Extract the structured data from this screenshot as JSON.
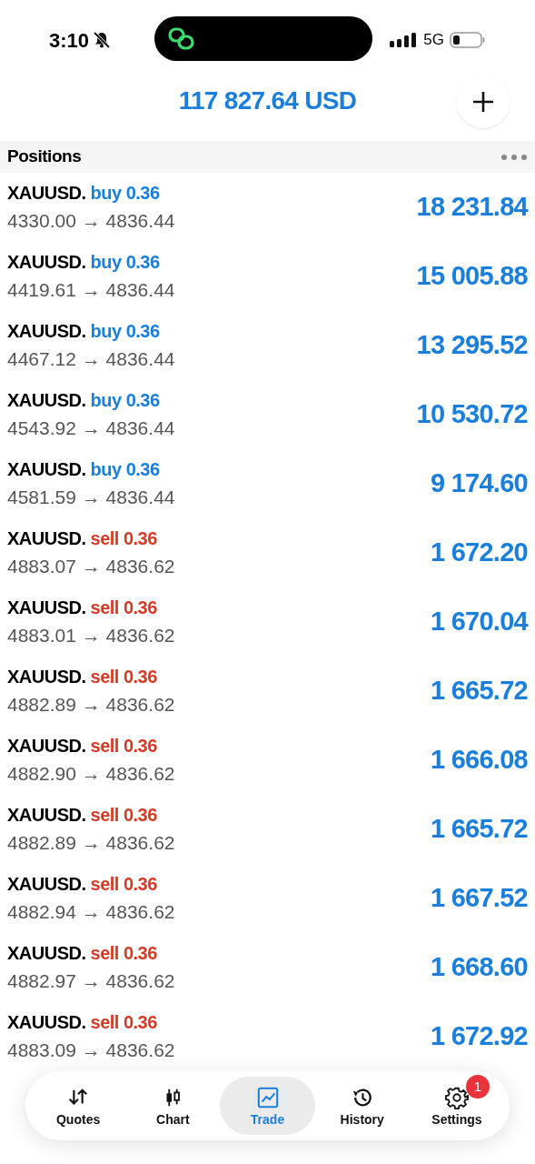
{
  "status_bar": {
    "time": "3:10",
    "network": "5G"
  },
  "balance": "117 827.64 USD",
  "section_title": "Positions",
  "positions": [
    {
      "symbol": "XAUUSD.",
      "order": "buy 0.36",
      "kind": "buy",
      "prices": "4330.00 → 4836.44",
      "profit": "18 231.84"
    },
    {
      "symbol": "XAUUSD.",
      "order": "buy 0.36",
      "kind": "buy",
      "prices": "4419.61 → 4836.44",
      "profit": "15 005.88"
    },
    {
      "symbol": "XAUUSD.",
      "order": "buy 0.36",
      "kind": "buy",
      "prices": "4467.12 → 4836.44",
      "profit": "13 295.52"
    },
    {
      "symbol": "XAUUSD.",
      "order": "buy 0.36",
      "kind": "buy",
      "prices": "4543.92 → 4836.44",
      "profit": "10 530.72"
    },
    {
      "symbol": "XAUUSD.",
      "order": "buy 0.36",
      "kind": "buy",
      "prices": "4581.59 → 4836.44",
      "profit": "9 174.60"
    },
    {
      "symbol": "XAUUSD.",
      "order": "sell 0.36",
      "kind": "sell",
      "prices": "4883.07 → 4836.62",
      "profit": "1 672.20"
    },
    {
      "symbol": "XAUUSD.",
      "order": "sell 0.36",
      "kind": "sell",
      "prices": "4883.01 → 4836.62",
      "profit": "1 670.04"
    },
    {
      "symbol": "XAUUSD.",
      "order": "sell 0.36",
      "kind": "sell",
      "prices": "4882.89 → 4836.62",
      "profit": "1 665.72"
    },
    {
      "symbol": "XAUUSD.",
      "order": "sell 0.36",
      "kind": "sell",
      "prices": "4882.90 → 4836.62",
      "profit": "1 666.08"
    },
    {
      "symbol": "XAUUSD.",
      "order": "sell 0.36",
      "kind": "sell",
      "prices": "4882.89 → 4836.62",
      "profit": "1 665.72"
    },
    {
      "symbol": "XAUUSD.",
      "order": "sell 0.36",
      "kind": "sell",
      "prices": "4882.94 → 4836.62",
      "profit": "1 667.52"
    },
    {
      "symbol": "XAUUSD.",
      "order": "sell 0.36",
      "kind": "sell",
      "prices": "4882.97 → 4836.62",
      "profit": "1 668.60"
    },
    {
      "symbol": "XAUUSD.",
      "order": "sell 0.36",
      "kind": "sell",
      "prices": "4883.09 → 4836.62",
      "profit": "1 672.92"
    }
  ],
  "tabs": [
    {
      "label": "Quotes",
      "kind": "quotes",
      "selected": false
    },
    {
      "label": "Chart",
      "kind": "chart",
      "selected": false
    },
    {
      "label": "Trade",
      "kind": "trade",
      "selected": true
    },
    {
      "label": "History",
      "kind": "history",
      "selected": false
    },
    {
      "label": "Settings",
      "kind": "settings",
      "selected": false,
      "badge": "1"
    }
  ]
}
